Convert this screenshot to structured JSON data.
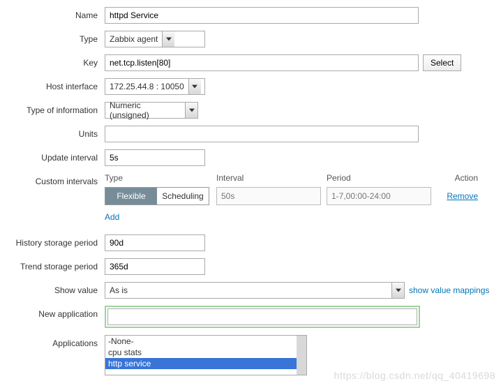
{
  "labels": {
    "name": "Name",
    "type": "Type",
    "key": "Key",
    "host_interface": "Host interface",
    "type_of_information": "Type of information",
    "units": "Units",
    "update_interval": "Update interval",
    "custom_intervals": "Custom intervals",
    "history_storage_period": "History storage period",
    "trend_storage_period": "Trend storage period",
    "show_value": "Show value",
    "new_application": "New application",
    "applications": "Applications"
  },
  "values": {
    "name": "httpd Service",
    "type": "Zabbix agent",
    "key": "net.tcp.listen[80]",
    "host_interface": "172.25.44.8 : 10050",
    "type_of_information": "Numeric (unsigned)",
    "units": "",
    "update_interval": "5s",
    "history_storage_period": "90d",
    "trend_storage_period": "365d",
    "show_value": "As is",
    "new_application": ""
  },
  "buttons": {
    "select": "Select",
    "show_value_mappings": "show value mappings",
    "remove": "Remove",
    "add": "Add"
  },
  "custom_intervals": {
    "headers": {
      "type": "Type",
      "interval": "Interval",
      "period": "Period",
      "action": "Action"
    },
    "row": {
      "flexible": "Flexible",
      "scheduling": "Scheduling",
      "interval_placeholder": "50s",
      "period_placeholder": "1-7,00:00-24:00"
    }
  },
  "applications_list": {
    "items": [
      "-None-",
      "cpu stats",
      "http service"
    ],
    "selected_index": 2
  },
  "watermark": "https://blog.csdn.net/qq_40419698"
}
